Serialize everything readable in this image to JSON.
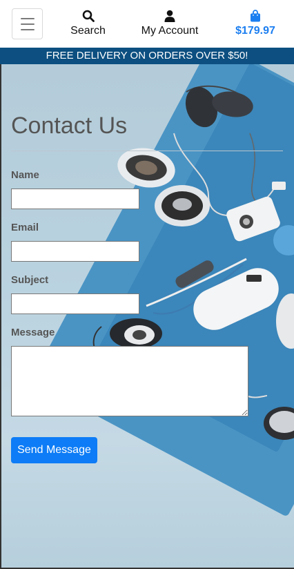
{
  "nav": {
    "search_label": "Search",
    "account_label": "My Account",
    "cart_total": "$179.97",
    "icons": [
      "menu-icon",
      "search-icon",
      "user-icon",
      "shopping-bag-icon"
    ],
    "cart_color": "#1b7ef0"
  },
  "banner": {
    "text": "FREE DELIVERY ON ORDERS OVER $50!",
    "bg": "#0c4f80"
  },
  "page": {
    "title": "Contact Us"
  },
  "form": {
    "name_label": "Name",
    "email_label": "Email",
    "subject_label": "Subject",
    "message_label": "Message",
    "name_value": "",
    "email_value": "",
    "subject_value": "",
    "message_value": "",
    "submit_label": "Send Message",
    "submit_color": "#0d7cf6"
  }
}
